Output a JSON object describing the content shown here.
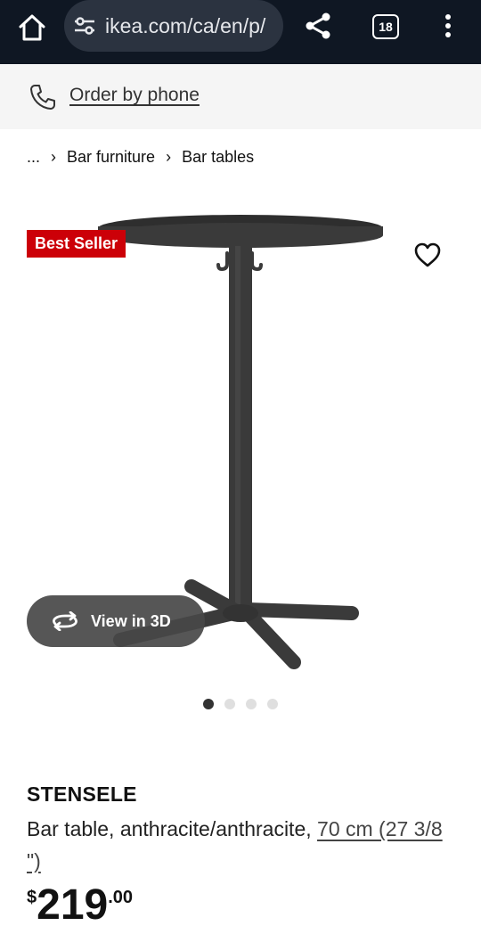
{
  "browser": {
    "url": "ikea.com/ca/en/p/",
    "tab_count": "18",
    "icons": [
      "home-icon",
      "tune-icon",
      "share-icon",
      "tab-switcher-icon",
      "more-vert-icon"
    ]
  },
  "phone_bar": {
    "label": "Order by phone",
    "icon": "phone-icon"
  },
  "breadcrumb": {
    "items": [
      "...",
      "Bar furniture",
      "Bar tables"
    ],
    "separator": "›"
  },
  "gallery": {
    "badge": "Best Seller",
    "view_3d_label": "View in 3D",
    "image_count": 4,
    "active_index": 0,
    "colors": {
      "badge": "#cc0008",
      "table": "#3a3a3a"
    }
  },
  "product": {
    "name": "STENSELE",
    "description": "Bar table, anthracite/anthracite,",
    "size": "70 cm (27 3/8 \")",
    "price": {
      "currency": "$",
      "integer": "219",
      "decimal": ".00"
    }
  }
}
